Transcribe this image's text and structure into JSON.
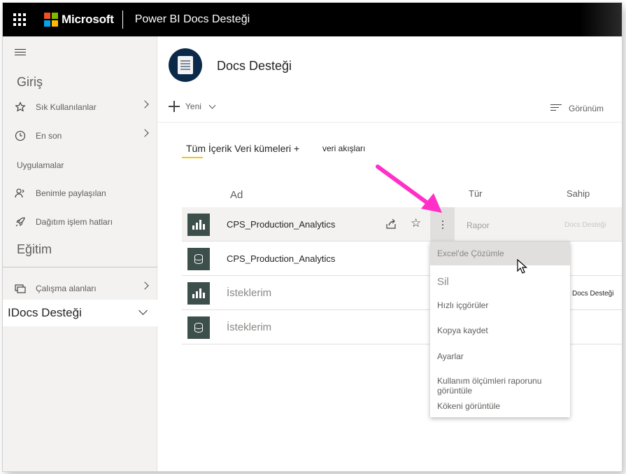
{
  "topbar": {
    "brand": "Microsoft",
    "app_title": "Power BI Docs Desteği",
    "logo_colors": [
      "#f25022",
      "#7fba00",
      "#00a4ef",
      "#ffb900"
    ]
  },
  "sidebar": {
    "menu_icon": "hamburger-icon",
    "home_heading": "Giriş",
    "items": [
      {
        "label": "Sık Kullanılanlar",
        "icon": "star-icon"
      },
      {
        "label": "En son",
        "icon": "clock-icon"
      }
    ],
    "apps_label": "Uygulamalar",
    "shared_label": "Benimle paylaşılan",
    "pipelines_label": "Dağıtım işlem hatları",
    "learning_heading": "Eğitim",
    "workspaces_label": "Çalışma alanları",
    "active_workspace": "IDocs Desteği"
  },
  "workspace": {
    "title": "Docs Desteği",
    "new_label": "Yeni",
    "view_label": "Görünüm"
  },
  "tabs": {
    "all_content": "Tüm İçerik Veri kümeleri +",
    "dataflows": "veri akışları"
  },
  "table": {
    "headers": {
      "name": "Ad",
      "type": "Tür",
      "owner": "Sahip"
    },
    "rows": [
      {
        "name": "CPS_Production_Analytics",
        "type": "Rapor",
        "owner": "Docs Desteği",
        "icon": "report-icon"
      },
      {
        "name": "CPS_Production_Analytics",
        "type": "",
        "owner": "",
        "icon": "dataset-icon"
      },
      {
        "name": "İsteklerim",
        "type": "",
        "owner": "Docs Desteği",
        "icon": "report-icon"
      },
      {
        "name": "İsteklerim",
        "type": "",
        "owner": "",
        "icon": "dataset-icon"
      }
    ]
  },
  "context_menu": {
    "items": [
      "Excel'de Çözümle",
      "Sil",
      "Hızlı içgörüler",
      "Kopya kaydet",
      "Ayarlar",
      "Kullanım ölçümleri raporunu görüntüle",
      "Kökeni görüntüle"
    ]
  },
  "colors": {
    "accent_yellow": "#f2c811",
    "annotation_arrow": "#ff2fc8",
    "row_icon_bg": "#3d4f4a"
  }
}
